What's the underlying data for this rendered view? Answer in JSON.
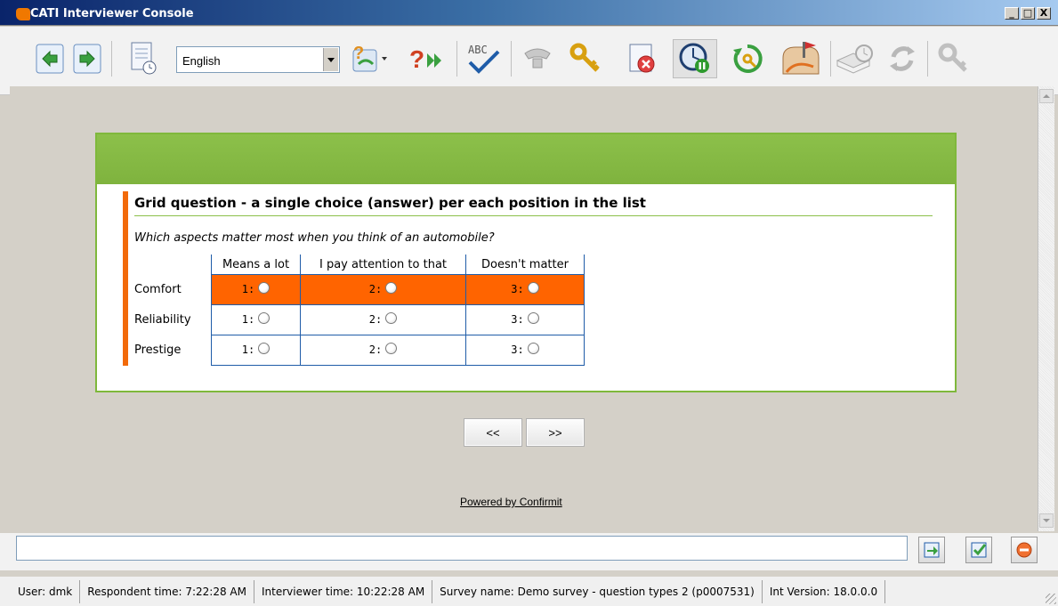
{
  "window": {
    "title": "CATI Interviewer Console",
    "controls": [
      "_",
      "□",
      "X"
    ]
  },
  "toolbar": {
    "language": "English",
    "buttons": [
      {
        "name": "back-icon",
        "color": "#2e9a2e"
      },
      {
        "name": "forward-icon",
        "color": "#2e9a2e"
      },
      {
        "name": "schedule-document-icon",
        "color": "#5a7fc0"
      },
      {
        "name": "help-question-icon",
        "color": "#e0a020"
      },
      {
        "name": "skip-question-icon",
        "color": "#d04020"
      },
      {
        "name": "spellcheck-icon",
        "label": "ABC",
        "color": "#1f5ca8"
      },
      {
        "name": "phone-icon",
        "color": "#b0b0b0"
      },
      {
        "name": "key-icon",
        "color": "#e8b020"
      },
      {
        "name": "cancel-icon",
        "color": "#d03030"
      },
      {
        "name": "clock-pause-icon",
        "color": "#1f5ca8"
      },
      {
        "name": "refresh-key-icon",
        "color": "#3aa040"
      },
      {
        "name": "mailbox-icon",
        "color": "#e07020"
      },
      {
        "name": "book-clock-icon",
        "color": "#b0b0b0"
      },
      {
        "name": "sync-icon",
        "color": "#b0b0b0"
      },
      {
        "name": "search-key-icon",
        "color": "#b0b0b0"
      }
    ]
  },
  "survey": {
    "question_title": "Grid question - a single choice (answer) per each position in the list",
    "question_text": "Which aspects matter most when you think of an automobile?",
    "columns": [
      "Means a lot",
      "I pay attention to that",
      "Doesn't matter"
    ],
    "rows": [
      {
        "label": "Comfort",
        "codes": [
          "1:",
          "2:",
          "3:"
        ]
      },
      {
        "label": "Reliability",
        "codes": [
          "1:",
          "2:",
          "3:"
        ]
      },
      {
        "label": "Prestige",
        "codes": [
          "1:",
          "2:",
          "3:"
        ]
      }
    ],
    "highlight_color": "#ff6400",
    "prev_label": "<<",
    "next_label": ">>",
    "powered_by": "Powered by Confirmit"
  },
  "command": {
    "input_value": "",
    "buttons": [
      "export-icon",
      "check-icon",
      "stop-icon"
    ]
  },
  "status": {
    "user": "User:  dmk",
    "respondent_time": "Respondent time:  7:22:28 AM",
    "interviewer_time": "Interviewer time:  10:22:28 AM",
    "survey_name": "Survey name:  Demo survey - question types 2 (p0007531)",
    "int_version": "Int Version:  18.0.0.0"
  }
}
